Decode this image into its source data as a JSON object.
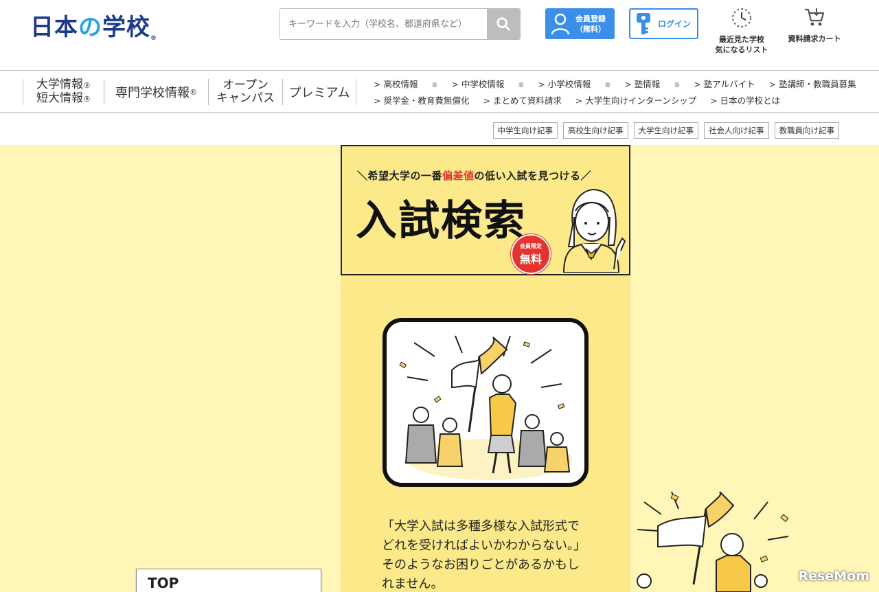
{
  "header": {
    "logo": {
      "main1": "日本",
      "no": "の",
      "main2": "学校",
      "reg": "®"
    },
    "search": {
      "placeholder": "キーワードを入力（学校名、都道府県など）"
    },
    "member": {
      "line1": "会員登録",
      "line2": "（無料）"
    },
    "login": {
      "label": "ログイン"
    },
    "recent": {
      "line1": "最近見た学校",
      "line2": "気になるリスト"
    },
    "cart": {
      "label": "資料請求カート"
    }
  },
  "nav": {
    "main": [
      {
        "l1": "大学情報",
        "l2": "短大情報",
        "mark": "®"
      },
      {
        "label": "専門学校情報",
        "mark": "®"
      },
      {
        "l1": "オープン",
        "l2": "キャンパス"
      },
      {
        "label": "プレミアム"
      }
    ],
    "sub_row1": [
      "> 高校情報",
      "> 中学校情報",
      "> 小学校情報",
      "> 塾情報",
      "> 塾アルバイト",
      "> 塾講師・教職員募集"
    ],
    "sub_row2": [
      "> 奨学金・教育費無償化",
      "> まとめて資料請求",
      "> 大学生向けインターンシップ",
      "> 日本の学校とは"
    ],
    "mark": "®"
  },
  "tags": [
    "中学生向け記事",
    "高校生向け記事",
    "大学生向け記事",
    "社会人向け記事",
    "教職員向け記事"
  ],
  "banner": {
    "catch_pre": "＼希望大学の一番",
    "catch_hl": "偏差値",
    "catch_post": "の低い入試を見つける／",
    "title": "入試検索",
    "stamp_small": "会員限定",
    "stamp_big": "無料"
  },
  "description": "「大学入試は多種多様な入試形式でどれを受ければよいかわからない。」そのようなお困りごとがあるかもしれません。",
  "top_box": {
    "label": "TOP"
  },
  "watermark": "ReseMom",
  "colors": {
    "brand_navy": "#1d3a8a",
    "brand_blue": "#3b8fe8",
    "yellow_light": "#fff6b8",
    "yellow": "#fbe98a",
    "red": "#e3342f"
  }
}
